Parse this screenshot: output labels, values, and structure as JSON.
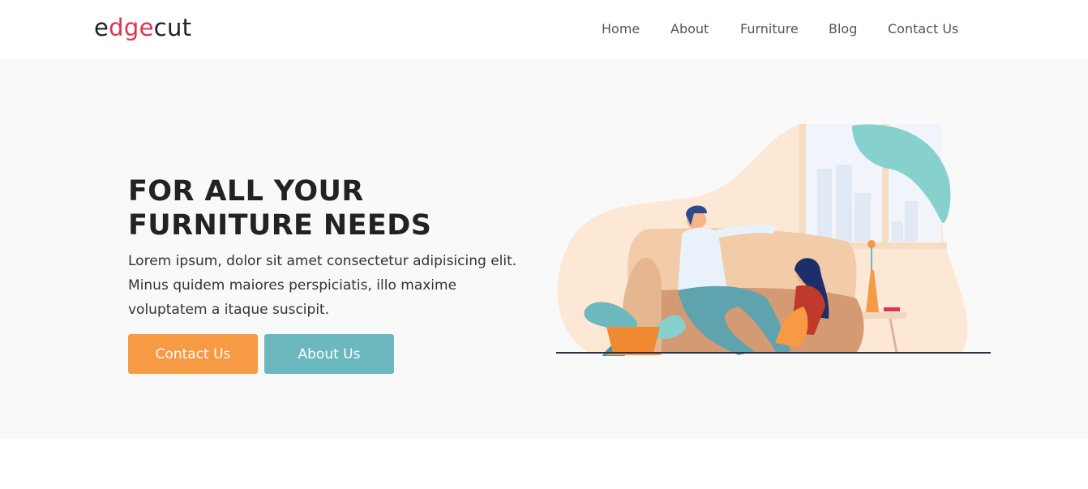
{
  "brand": {
    "logo_parts": [
      "e",
      "dge",
      "cut"
    ],
    "accent_color": "#e0344e"
  },
  "nav": {
    "items": [
      {
        "label": "Home"
      },
      {
        "label": "About"
      },
      {
        "label": "Furniture"
      },
      {
        "label": "Blog"
      },
      {
        "label": "Contact Us"
      }
    ]
  },
  "hero": {
    "title_line1": "FOR ALL YOUR",
    "title_line2": "FURNITURE NEEDS",
    "description": "Lorem ipsum, dolor sit amet consectetur adipisicing elit. Minus quidem maiores perspiciatis, illo maxime voluptatem a itaque suscipit.",
    "buttons": {
      "contact_label": "Contact Us",
      "contact_color": "#f79a44",
      "about_label": "About Us",
      "about_color": "#6bb8bf"
    }
  },
  "colors": {
    "hero_background": "#f9f9f9",
    "illustration_blob": "#fce8d5"
  }
}
